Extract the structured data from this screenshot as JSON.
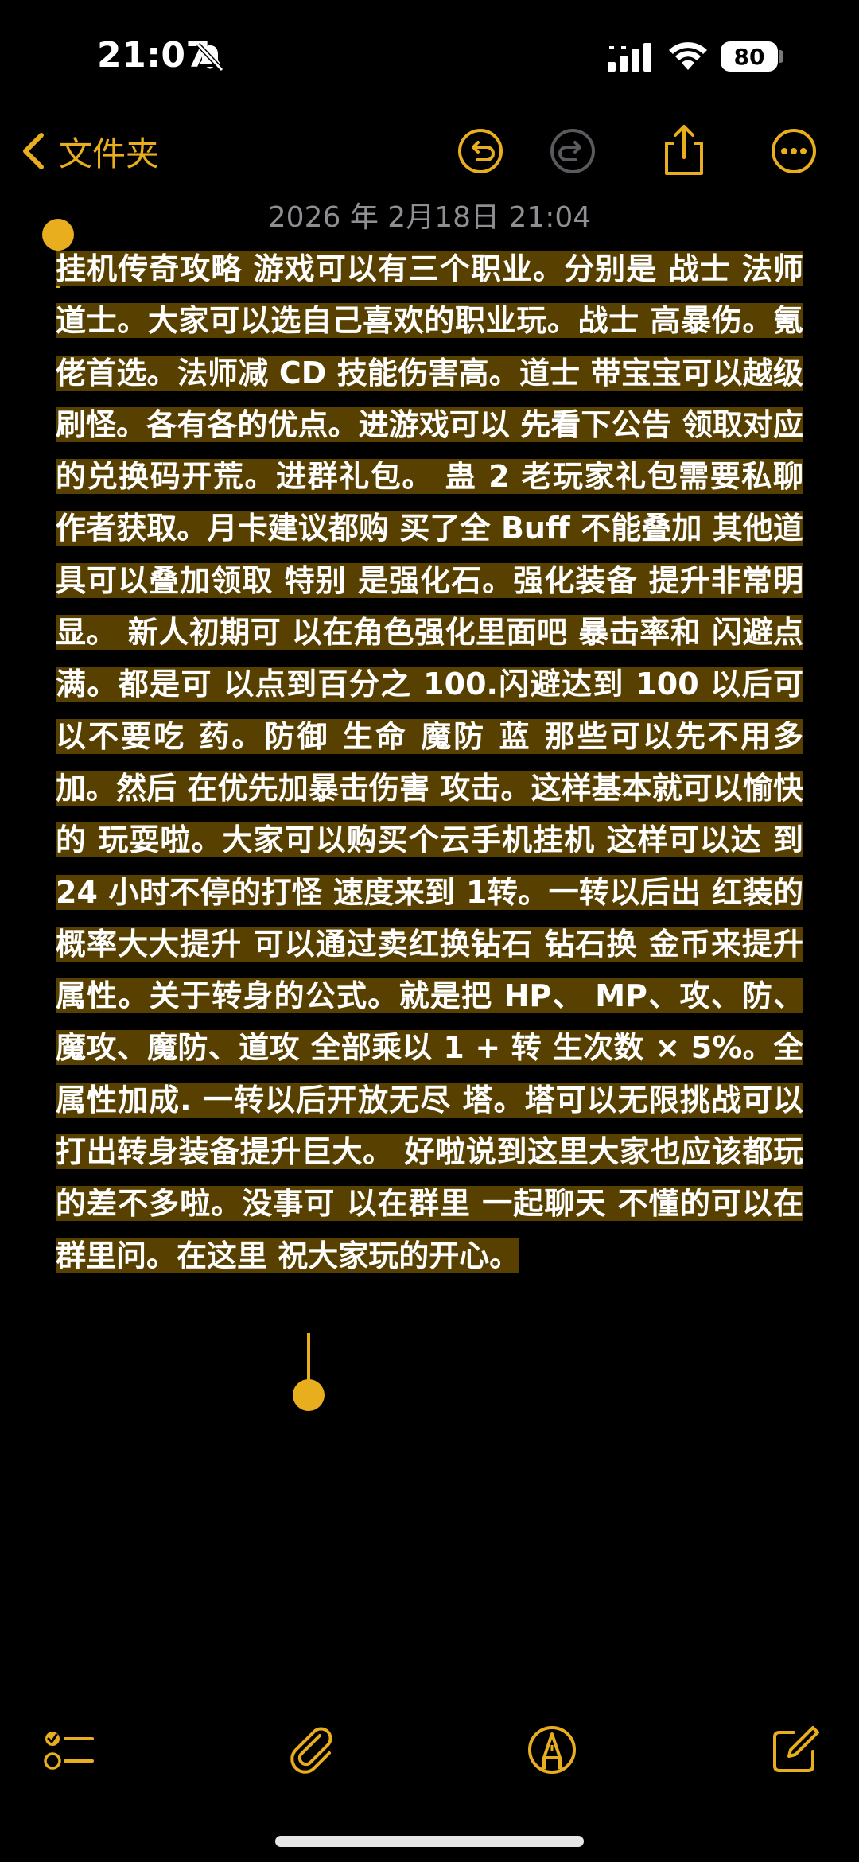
{
  "status_bar": {
    "time": "21:07",
    "battery": "80",
    "icons": [
      "bell-slash-icon",
      "cellular-signal-icon",
      "wifi-icon",
      "battery-icon"
    ]
  },
  "nav": {
    "back_label": "文件夹",
    "icons": [
      "chevron-left-icon",
      "undo-icon",
      "redo-icon",
      "share-icon",
      "more-icon"
    ]
  },
  "note": {
    "date": "2026 年 2月18日 21:04",
    "body": "挂机传奇攻略 游戏可以有三个职业。分别是 战士 法师 道士。大家可以选自己喜欢的职业玩。战士 高暴伤。氪佬首选。法师减 CD 技能伤害高。道士 带宝宝可以越级刷怪。各有各的优点。进游戏可以 先看下公告 领取对应的兑换码开荒。进群礼包。 蛊 2 老玩家礼包需要私聊作者获取。月卡建议都购 买了全 Buff 不能叠加 其他道具可以叠加领取 特别 是强化石。强化装备 提升非常明显。 新人初期可 以在角色强化里面吧 暴击率和 闪避点满。都是可 以点到百分之 100.闪避达到 100 以后可以不要吃 药。防御 生命 魔防 蓝 那些可以先不用多加。然后 在优先加暴击伤害 攻击。这样基本就可以愉快的 玩耍啦。大家可以购买个云手机挂机 这样可以达 到 24 小时不停的打怪 速度来到 1转。一转以后出 红装的概率大大提升 可以通过卖红换钻石 钻石换 金币来提升属性。关于转身的公式。就是把 HP、 MP、攻、防、魔攻、魔防、道攻 全部乘以 1 + 转 生次数 × 5%。全属性加成. 一转以后开放无尽 塔。塔可以无限挑战可以打出转身装备提升巨大。 好啦说到这里大家也应该都玩的差不多啦。没事可 以在群里 一起聊天 不懂的可以在群里问。在这里 祝大家玩的开心。",
    "selection_color": "#584000"
  },
  "toolbar": {
    "icons": [
      "checklist-icon",
      "paperclip-icon",
      "markup-pen-icon",
      "compose-icon"
    ]
  },
  "colors": {
    "accent": "#e8ae1e",
    "background": "#000000",
    "selection": "#584000",
    "date_text": "#8e8e93"
  }
}
